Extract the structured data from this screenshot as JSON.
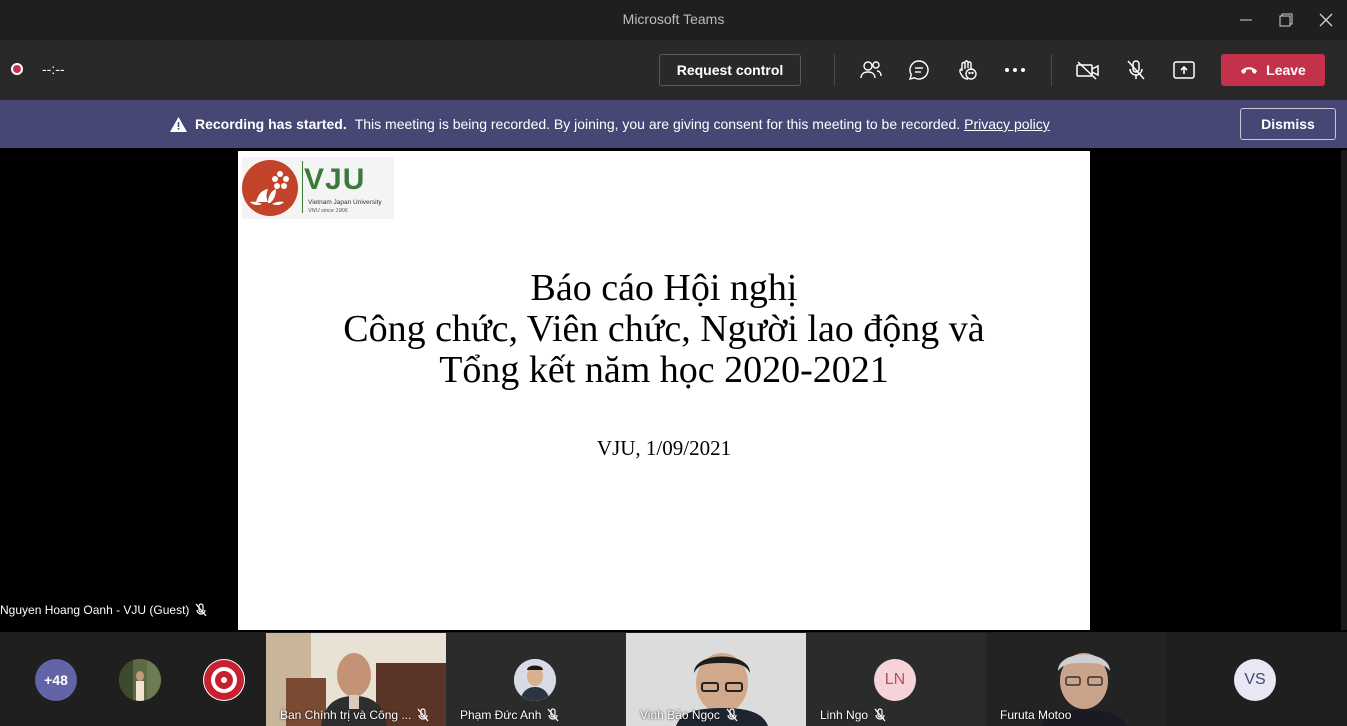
{
  "window": {
    "title": "Microsoft Teams"
  },
  "toolbar": {
    "timer": "--:--",
    "request_control": "Request control",
    "leave": "Leave"
  },
  "banner": {
    "bold": "Recording has started.",
    "text": "This meeting is being recorded. By joining, you are giving consent for this meeting to be recorded.",
    "link": "Privacy policy",
    "dismiss": "Dismiss"
  },
  "slide": {
    "logo": {
      "brand": "VJU",
      "sub1": "Vietnam Japan University",
      "sub2": "VNU since 1906"
    },
    "title_lines": [
      "Báo cáo Hội nghị",
      "Công chức, Viên chức, Người lao động và",
      "Tổng kết năm học 2020-2021"
    ],
    "subtitle": "VJU, 1/09/2021"
  },
  "presenter": {
    "name": "Nguyen Hoang Oanh - VJU (Guest)"
  },
  "participants": {
    "overflow": "+48",
    "tiles": [
      {
        "name": "Ban Chính trị và Công ..."
      },
      {
        "name": "Phạm Đức Anh"
      },
      {
        "name": "Vinh Bảo Ngọc"
      },
      {
        "name": "Linh Ngo",
        "initials": "LN"
      },
      {
        "name": "Furuta Motoo"
      }
    ],
    "vs_initials": "VS"
  },
  "colors": {
    "leave": "#c4314b",
    "banner": "#464775",
    "toolbar": "#292929",
    "logo_red": "#c0432a",
    "logo_green": "#3c7a3a"
  }
}
